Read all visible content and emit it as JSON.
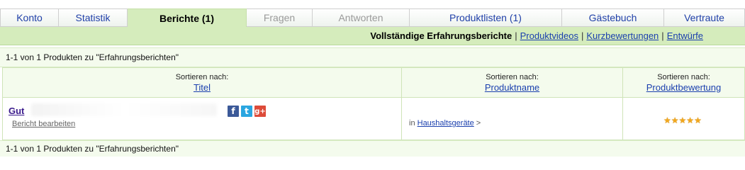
{
  "tabs": [
    {
      "label": "Konto",
      "state": "normal"
    },
    {
      "label": "Statistik",
      "state": "normal"
    },
    {
      "label": "Berichte (1)",
      "state": "active"
    },
    {
      "label": "Fragen",
      "state": "disabled"
    },
    {
      "label": "Antworten",
      "state": "disabled"
    },
    {
      "label": "Produktlisten (1)",
      "state": "normal"
    },
    {
      "label": "Gästebuch",
      "state": "normal"
    },
    {
      "label": "Vertraute",
      "state": "normal"
    }
  ],
  "subnav": {
    "current": "Vollständige Erfahrungsberichte",
    "separator": "|",
    "links": [
      "Produktvideos",
      "Kurzbewertungen",
      "Entwürfe"
    ]
  },
  "count_text": "1-1 von 1 Produkten zu \"Erfahrungsberichten\"",
  "table": {
    "sort_label": "Sortieren nach:",
    "columns": [
      "Titel",
      "Produktname",
      "Produktbewertung"
    ],
    "rows": [
      {
        "title": "Gut",
        "edit_label": "Bericht bearbeiten",
        "category_prefix": "in",
        "category": "Haushaltsgeräte",
        "category_suffix": ">",
        "rating": 5,
        "social": {
          "facebook": "f",
          "twitter": "t",
          "googleplus": "g+"
        }
      }
    ]
  },
  "colors": {
    "accent_green": "#d5ecbc",
    "link_blue": "#1a3fae",
    "star_orange": "#f2a81d"
  }
}
